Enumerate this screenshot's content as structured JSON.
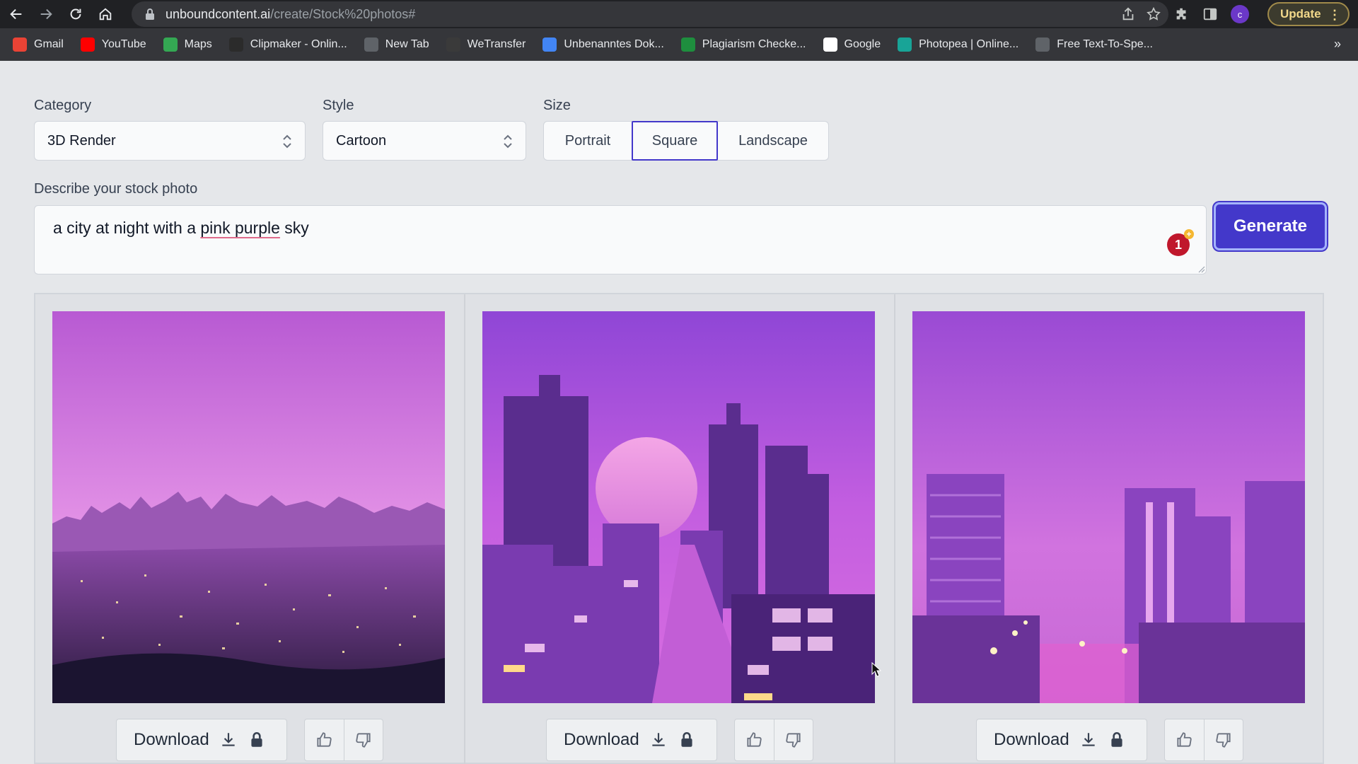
{
  "browser": {
    "url_host": "unboundcontent.ai",
    "url_path": "/create/Stock%20photos#",
    "profile_initial": "c",
    "update_label": "Update",
    "bookmarks": [
      {
        "label": "Gmail",
        "icon": "gmail-icon",
        "color": "#ea4335"
      },
      {
        "label": "YouTube",
        "icon": "youtube-icon",
        "color": "#ff0000"
      },
      {
        "label": "Maps",
        "icon": "maps-icon",
        "color": "#34a853"
      },
      {
        "label": "Clipmaker - Onlin...",
        "icon": "clipmaker-icon",
        "color": "#2b2b2b"
      },
      {
        "label": "New Tab",
        "icon": "globe-icon",
        "color": "#5f6368"
      },
      {
        "label": "WeTransfer",
        "icon": "wetransfer-icon",
        "color": "#3a3a3a"
      },
      {
        "label": "Unbenanntes Dok...",
        "icon": "docs-icon",
        "color": "#4285f4"
      },
      {
        "label": "Plagiarism Checke...",
        "icon": "plagiarism-icon",
        "color": "#1e8e3e"
      },
      {
        "label": "Google",
        "icon": "google-icon",
        "color": "#ffffff"
      },
      {
        "label": "Photopea | Online...",
        "icon": "photopea-icon",
        "color": "#18a497"
      },
      {
        "label": "Free Text-To-Spe...",
        "icon": "page-icon",
        "color": "#5f6368"
      }
    ],
    "more_label": "»"
  },
  "form": {
    "category_label": "Category",
    "category_value": "3D Render",
    "style_label": "Style",
    "style_value": "Cartoon",
    "size_label": "Size",
    "size_options": [
      "Portrait",
      "Square",
      "Landscape"
    ],
    "size_selected": "Square",
    "describe_label": "Describe your stock photo",
    "prompt_before": "a city at night with a ",
    "prompt_misspelled": "pink purple",
    "prompt_after": " sky",
    "badge_count": "1",
    "generate_label": "Generate"
  },
  "results": {
    "download_label": "Download",
    "images": [
      {
        "alt": "city skyline at dusk"
      },
      {
        "alt": "city street with setting sun"
      },
      {
        "alt": "modern buildings with street lamps"
      }
    ]
  },
  "colors": {
    "accent": "#4338ca",
    "sky_pink": "#d77ad9",
    "sky_purple": "#8a3fc6"
  }
}
